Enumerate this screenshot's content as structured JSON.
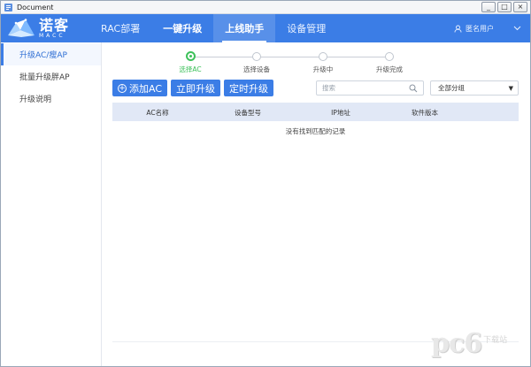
{
  "window": {
    "title": "Document",
    "controls": [
      "_",
      "□",
      "×"
    ]
  },
  "brand": {
    "name_cn": "诺客",
    "name_en": "MACC"
  },
  "topnav": {
    "items": [
      {
        "label": "RAC部署",
        "state": "normal"
      },
      {
        "label": "一键升级",
        "state": "active"
      },
      {
        "label": "上线助手",
        "state": "highlighted"
      },
      {
        "label": "设备管理",
        "state": "normal"
      }
    ],
    "user": "匿名用户",
    "accent": "#3b7de6"
  },
  "sidebar": {
    "items": [
      {
        "label": "升级AC/瘦AP",
        "active": true
      },
      {
        "label": "批量升级胖AP",
        "active": false
      },
      {
        "label": "升级说明",
        "active": false
      }
    ]
  },
  "steps": {
    "items": [
      {
        "label": "选择AC",
        "active": true
      },
      {
        "label": "选择设备",
        "active": false
      },
      {
        "label": "升级中",
        "active": false
      },
      {
        "label": "升级完成",
        "active": false
      }
    ],
    "active_color": "#3ec15b"
  },
  "toolbar": {
    "add_label": "添加AC",
    "upgrade_now_label": "立即升级",
    "scheduled_label": "定时升级"
  },
  "search": {
    "placeholder": "搜索"
  },
  "group_select": {
    "value": "全部分组"
  },
  "table": {
    "columns": [
      "AC名称",
      "设备型号",
      "IP地址",
      "软件版本"
    ],
    "empty_text": "没有找到匹配的记录"
  },
  "watermark": {
    "logo": "pc6",
    "site": "下载站"
  }
}
